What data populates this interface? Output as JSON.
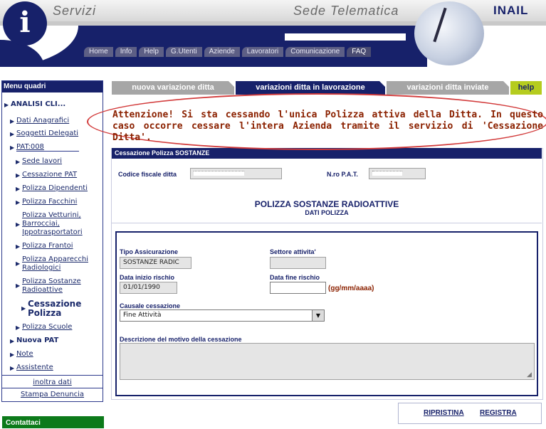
{
  "header": {
    "logo_letter": "i",
    "left_title": "Servizi",
    "right_title": "Sede Telematica",
    "brand": "INAIL",
    "nav": [
      "Home",
      "Info",
      "Help",
      "G.Utenti",
      "Aziende",
      "Lavoratori",
      "Comunicazione",
      "FAQ"
    ]
  },
  "menu": {
    "title": "Menu quadri",
    "items": [
      {
        "label": "ANALISI CLI..."
      },
      {
        "label": "Dati Anagrafici"
      },
      {
        "label": "Soggetti Delegati"
      },
      {
        "label": "PAT:008"
      },
      {
        "label": "Sede lavori"
      },
      {
        "label": "Cessazione PAT"
      },
      {
        "label": "Polizza Dipendenti"
      },
      {
        "label": "Polizza Facchini"
      },
      {
        "label": "Polizza Vetturini, Barrocciai, Ippotrasportatori"
      },
      {
        "label": "Polizza Frantoi"
      },
      {
        "label": "Polizza Apparecchi Radiologici"
      },
      {
        "label": "Polizza Sostanze Radioattive"
      },
      {
        "label": "Cessazione Polizza"
      },
      {
        "label": "Polizza Scuole"
      },
      {
        "label": "Nuova PAT"
      },
      {
        "label": "Note"
      },
      {
        "label": "Assistente"
      }
    ],
    "links": [
      "inoltra dati",
      "Stampa Denuncia"
    ],
    "contact": "Contattaci"
  },
  "tabs": {
    "new": "nuova variazione ditta",
    "in_progress": "variazioni ditta in lavorazione",
    "sent": "variazioni ditta inviate",
    "help": "help"
  },
  "warning": "Attenzione! Si sta cessando l'unica Polizza attiva della Ditta. In questo caso occorre cessare l'intera Azienda tramite il servizio di 'Cessazione Ditta'.",
  "form": {
    "panel_title": "Cessazione Polizza SOSTANZE",
    "codice_fiscale_label": "Codice fiscale ditta",
    "npat_label": "N.ro P.A.T.",
    "polizza_title": "POLIZZA SOSTANZE RADIOATTIVE",
    "polizza_subtitle": "DATI POLIZZA",
    "tipo_label": "Tipo Assicurazione",
    "tipo_value": "SOSTANZE RADIC",
    "settore_label": "Settore attivita'",
    "settore_value": "",
    "data_inizio_label": "Data inizio rischio",
    "data_inizio_value": "01/01/1990",
    "data_fine_label": "Data fine rischio",
    "data_fine_value": "",
    "data_fine_hint": "(gg/mm/aaaa)",
    "causale_label": "Causale cessazione",
    "causale_value": "Fine Attività",
    "descrizione_label": "Descrizione del motivo della cessazione"
  },
  "actions": {
    "reset": "RIPRISTINA",
    "save": "REGISTRA"
  },
  "colors": {
    "navy": "#17216a",
    "warning_red": "#8b2100",
    "ellipse_red": "#d23a3a",
    "help_green": "#b5cc1f",
    "contact_green": "#0c7a1a"
  }
}
